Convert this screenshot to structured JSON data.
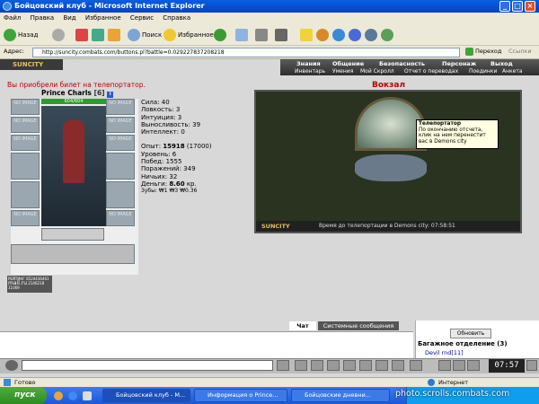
{
  "window": {
    "title": "Бойцовский клуб - Microsoft Internet Explorer"
  },
  "menu": [
    "Файл",
    "Правка",
    "Вид",
    "Избранное",
    "Сервис",
    "Справка"
  ],
  "toolbar": {
    "back": "Назад",
    "search": "Поиск",
    "favorites": "Избранное"
  },
  "address": {
    "label": "Адрес:",
    "url": "http://suncity.combats.com/buttons.pl?battle=0.029227837208218",
    "go": "Переход",
    "links": "Ссылки"
  },
  "logo": "SUNCITY",
  "nav": {
    "top": [
      "Знания",
      "Общение",
      "Безопасность",
      "Персонаж",
      "Выход"
    ],
    "sub": [
      "Инвентарь",
      "Умения",
      "Мой Скролл",
      "Отчет о переводах",
      "Поединки",
      "Анкета"
    ]
  },
  "notice": "Вы приобрели билет на телепортатор.",
  "character": {
    "name": "Prince Charls",
    "level": "[6]",
    "hp": "604/604",
    "slot_label": "NO IMAGE",
    "rating_label": "РЕЙТИНГ",
    "rating_values": [
      "8524436461",
      "2146218",
      "11069"
    ],
    "rating_site": "mail.ru"
  },
  "stats": [
    {
      "label": "Сила:",
      "value": "40"
    },
    {
      "label": "Ловкость:",
      "value": "3"
    },
    {
      "label": "Интуиция:",
      "value": "3"
    },
    {
      "label": "Выносливость:",
      "value": "39"
    },
    {
      "label": "Интеллект:",
      "value": "0"
    }
  ],
  "stats2": [
    {
      "label": "Опыт:",
      "value": "15918",
      "extra": "(17000)"
    },
    {
      "label": "Уровень:",
      "value": "6"
    },
    {
      "label": "Побед:",
      "value": "1555"
    },
    {
      "label": "Поражений:",
      "value": "349"
    },
    {
      "label": "Ничьих:",
      "value": "32"
    },
    {
      "label": "Деньги:",
      "value": "8.60",
      "extra": "кр."
    },
    {
      "label": "Зубы:",
      "value": "₩1 ₩3 ₩0.36"
    }
  ],
  "location": {
    "title": "Вокзал",
    "scene_logo": "SUNCITY",
    "scene_caption": "Время до телепортации в Demons city: 07:58:51",
    "tooltip_title": "Телепортатор",
    "tooltip_text": "По окончанию отсчета, клик на нем перенестит вас в Demons city"
  },
  "chat": {
    "tab_chat": "Чат",
    "tab_system": "Системные сообщения"
  },
  "right_panel": {
    "refresh": "Обновить",
    "title": "Багажное отделение (3)",
    "user": "Devil rnd[11]"
  },
  "clock": "07:57",
  "status": {
    "left": "Готово",
    "right": "Интернет"
  },
  "taskbar": {
    "start": "пуск",
    "tasks": [
      "Бойцовский клуб - М...",
      "Информация о Prince...",
      "Бойцовские дневни..."
    ],
    "watermark": "photo.scrolls.combats.com"
  },
  "colors": {
    "title_blue": "#0a5ee0",
    "notice_red": "#c00000",
    "taskbar_blue": "#245edb",
    "start_green": "#3a9c2e"
  }
}
